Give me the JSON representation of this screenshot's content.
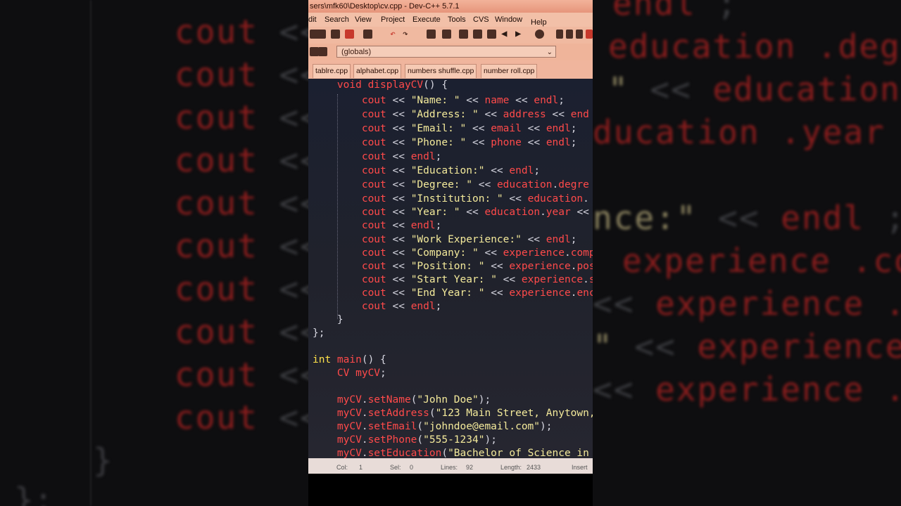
{
  "window": {
    "title": "sers\\mfk60\\Desktop\\cv.cpp - Dev-C++ 5.7.1"
  },
  "menu": {
    "items": [
      "dit",
      "Search",
      "View",
      "Project",
      "Execute",
      "Tools",
      "CVS",
      "Window",
      "Help"
    ]
  },
  "globals_select": {
    "value": "(globals)"
  },
  "tabs": [
    {
      "label": "tablre.cpp"
    },
    {
      "label": "alphabet.cpp"
    },
    {
      "label": "numbers shuffle.cpp"
    },
    {
      "label": "number roll.cpp"
    }
  ],
  "code": [
    [
      [
        "kw",
        "    void "
      ],
      [
        "id",
        "displayCV"
      ],
      [
        "pun",
        "() {"
      ]
    ],
    [
      [
        "kw",
        "        cout "
      ],
      [
        "op",
        "<< "
      ],
      [
        "str",
        "\"Name: \" "
      ],
      [
        "op",
        "<< "
      ],
      [
        "id",
        "name "
      ],
      [
        "op",
        "<< "
      ],
      [
        "kw",
        "endl"
      ],
      [
        "pun",
        ";"
      ]
    ],
    [
      [
        "kw",
        "        cout "
      ],
      [
        "op",
        "<< "
      ],
      [
        "str",
        "\"Address: \" "
      ],
      [
        "op",
        "<< "
      ],
      [
        "id",
        "address "
      ],
      [
        "op",
        "<< "
      ],
      [
        "kw",
        "end"
      ]
    ],
    [
      [
        "kw",
        "        cout "
      ],
      [
        "op",
        "<< "
      ],
      [
        "str",
        "\"Email: \" "
      ],
      [
        "op",
        "<< "
      ],
      [
        "id",
        "email "
      ],
      [
        "op",
        "<< "
      ],
      [
        "kw",
        "endl"
      ],
      [
        "pun",
        ";"
      ]
    ],
    [
      [
        "kw",
        "        cout "
      ],
      [
        "op",
        "<< "
      ],
      [
        "str",
        "\"Phone: \" "
      ],
      [
        "op",
        "<< "
      ],
      [
        "id",
        "phone "
      ],
      [
        "op",
        "<< "
      ],
      [
        "kw",
        "endl"
      ],
      [
        "pun",
        ";"
      ]
    ],
    [
      [
        "kw",
        "        cout "
      ],
      [
        "op",
        "<< "
      ],
      [
        "kw",
        "endl"
      ],
      [
        "pun",
        ";"
      ]
    ],
    [
      [
        "kw",
        "        cout "
      ],
      [
        "op",
        "<< "
      ],
      [
        "str",
        "\"Education:\" "
      ],
      [
        "op",
        "<< "
      ],
      [
        "kw",
        "endl"
      ],
      [
        "pun",
        ";"
      ]
    ],
    [
      [
        "kw",
        "        cout "
      ],
      [
        "op",
        "<< "
      ],
      [
        "str",
        "\"Degree: \" "
      ],
      [
        "op",
        "<< "
      ],
      [
        "id",
        "education"
      ],
      [
        "pun",
        "."
      ],
      [
        "id",
        "degre"
      ]
    ],
    [
      [
        "kw",
        "        cout "
      ],
      [
        "op",
        "<< "
      ],
      [
        "str",
        "\"Institution: \" "
      ],
      [
        "op",
        "<< "
      ],
      [
        "id",
        "education"
      ],
      [
        "pun",
        "."
      ]
    ],
    [
      [
        "kw",
        "        cout "
      ],
      [
        "op",
        "<< "
      ],
      [
        "str",
        "\"Year: \" "
      ],
      [
        "op",
        "<< "
      ],
      [
        "id",
        "education"
      ],
      [
        "pun",
        "."
      ],
      [
        "id",
        "year "
      ],
      [
        "op",
        "<<"
      ]
    ],
    [
      [
        "kw",
        "        cout "
      ],
      [
        "op",
        "<< "
      ],
      [
        "kw",
        "endl"
      ],
      [
        "pun",
        ";"
      ]
    ],
    [
      [
        "kw",
        "        cout "
      ],
      [
        "op",
        "<< "
      ],
      [
        "str",
        "\"Work Experience:\" "
      ],
      [
        "op",
        "<< "
      ],
      [
        "kw",
        "endl"
      ],
      [
        "pun",
        ";"
      ]
    ],
    [
      [
        "kw",
        "        cout "
      ],
      [
        "op",
        "<< "
      ],
      [
        "str",
        "\"Company: \" "
      ],
      [
        "op",
        "<< "
      ],
      [
        "id",
        "experience"
      ],
      [
        "pun",
        "."
      ],
      [
        "id",
        "comp"
      ]
    ],
    [
      [
        "kw",
        "        cout "
      ],
      [
        "op",
        "<< "
      ],
      [
        "str",
        "\"Position: \" "
      ],
      [
        "op",
        "<< "
      ],
      [
        "id",
        "experience"
      ],
      [
        "pun",
        "."
      ],
      [
        "id",
        "pos"
      ]
    ],
    [
      [
        "kw",
        "        cout "
      ],
      [
        "op",
        "<< "
      ],
      [
        "str",
        "\"Start Year: \" "
      ],
      [
        "op",
        "<< "
      ],
      [
        "id",
        "experience"
      ],
      [
        "pun",
        "."
      ],
      [
        "id",
        "s"
      ]
    ],
    [
      [
        "kw",
        "        cout "
      ],
      [
        "op",
        "<< "
      ],
      [
        "str",
        "\"End Year: \" "
      ],
      [
        "op",
        "<< "
      ],
      [
        "id",
        "experience"
      ],
      [
        "pun",
        "."
      ],
      [
        "id",
        "enc"
      ]
    ],
    [
      [
        "kw",
        "        cout "
      ],
      [
        "op",
        "<< "
      ],
      [
        "kw",
        "endl"
      ],
      [
        "pun",
        ";"
      ]
    ],
    [
      [
        "pun",
        "    }"
      ]
    ],
    [
      [
        "pun",
        "};"
      ]
    ],
    [
      [
        "pun",
        ""
      ]
    ],
    [
      [
        "ty",
        "int "
      ],
      [
        "id",
        "main"
      ],
      [
        "pun",
        "() {"
      ]
    ],
    [
      [
        "id",
        "    CV myCV"
      ],
      [
        "pun",
        ";"
      ]
    ],
    [
      [
        "pun",
        ""
      ]
    ],
    [
      [
        "id",
        "    myCV"
      ],
      [
        "pun",
        "."
      ],
      [
        "id",
        "setName"
      ],
      [
        "pun",
        "("
      ],
      [
        "str",
        "\"John Doe\""
      ],
      [
        "pun",
        ");"
      ]
    ],
    [
      [
        "id",
        "    myCV"
      ],
      [
        "pun",
        "."
      ],
      [
        "id",
        "setAddress"
      ],
      [
        "pun",
        "("
      ],
      [
        "str",
        "\"123 Main Street, Anytown, "
      ]
    ],
    [
      [
        "id",
        "    myCV"
      ],
      [
        "pun",
        "."
      ],
      [
        "id",
        "setEmail"
      ],
      [
        "pun",
        "("
      ],
      [
        "str",
        "\"johndoe@email.com\""
      ],
      [
        "pun",
        ");"
      ]
    ],
    [
      [
        "id",
        "    myCV"
      ],
      [
        "pun",
        "."
      ],
      [
        "id",
        "setPhone"
      ],
      [
        "pun",
        "("
      ],
      [
        "str",
        "\"555-1234\""
      ],
      [
        "pun",
        ");"
      ]
    ],
    [
      [
        "id",
        "    myCV"
      ],
      [
        "pun",
        "."
      ],
      [
        "id",
        "setEducation"
      ],
      [
        "pun",
        "("
      ],
      [
        "str",
        "\"Bachelor of Science in "
      ]
    ]
  ],
  "status": {
    "col_label": "Col:",
    "col_value": "1",
    "sel_label": "Sel:",
    "sel_value": "0",
    "lines_label": "Lines:",
    "lines_value": "92",
    "length_label": "Length:",
    "length_value": "2433",
    "mode": "Insert"
  },
  "background_text": {
    "left_token": "cout",
    "left_op": "<<",
    "right": [
      [
        "endl",
        ";"
      ],
      [
        "education",
        ".degre"
      ],
      [
        "\"",
        "<<",
        "education",
        "."
      ],
      [
        "ducation",
        ".year",
        "<<"
      ],
      [
        ""
      ],
      [
        "nce:\"",
        "<<",
        "endl",
        ";"
      ],
      [
        "experience",
        ".comp"
      ],
      [
        "<<",
        "experience",
        ".pos"
      ],
      [
        "\"",
        "<<",
        "experience",
        ".s"
      ],
      [
        "<<",
        "experience",
        ".enc"
      ]
    ],
    "left_brace": "}",
    "left_semi": "};"
  }
}
